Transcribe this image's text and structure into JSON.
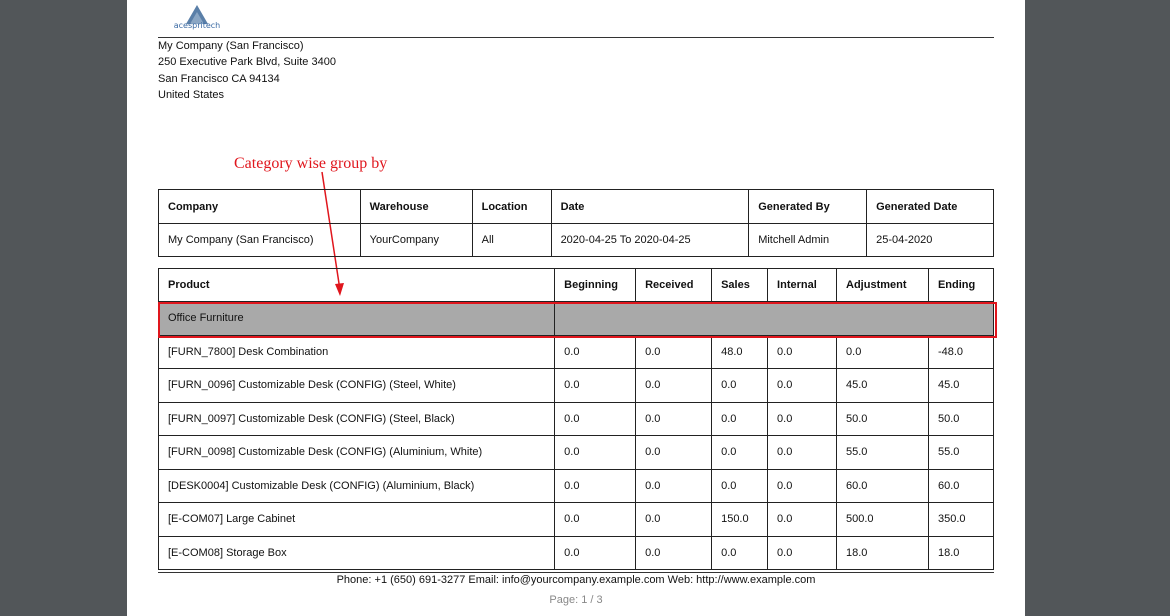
{
  "company": {
    "logo_text": "acespritech",
    "address_lines": [
      "My Company (San Francisco)",
      "250 Executive Park Blvd, Suite 3400",
      "San Francisco CA 94134",
      "United States"
    ]
  },
  "annotation": {
    "text": "Category wise group by",
    "color": "#e0161d"
  },
  "info_table": {
    "headers": [
      "Company",
      "Warehouse",
      "Location",
      "Date",
      "Generated By",
      "Generated Date"
    ],
    "values": [
      "My Company (San Francisco)",
      "YourCompany",
      "All",
      "2020-04-25 To 2020-04-25",
      "Mitchell Admin",
      "25-04-2020"
    ]
  },
  "inventory_table": {
    "headers": [
      "Product",
      "Beginning",
      "Received",
      "Sales",
      "Internal",
      "Adjustment",
      "Ending"
    ],
    "category": "Office Furniture",
    "rows": [
      [
        "[FURN_7800] Desk Combination",
        "0.0",
        "0.0",
        "48.0",
        "0.0",
        "0.0",
        "-48.0"
      ],
      [
        "[FURN_0096] Customizable Desk (CONFIG) (Steel, White)",
        "0.0",
        "0.0",
        "0.0",
        "0.0",
        "45.0",
        "45.0"
      ],
      [
        "[FURN_0097] Customizable Desk (CONFIG) (Steel, Black)",
        "0.0",
        "0.0",
        "0.0",
        "0.0",
        "50.0",
        "50.0"
      ],
      [
        "[FURN_0098] Customizable Desk (CONFIG) (Aluminium, White)",
        "0.0",
        "0.0",
        "0.0",
        "0.0",
        "55.0",
        "55.0"
      ],
      [
        "[DESK0004] Customizable Desk (CONFIG) (Aluminium, Black)",
        "0.0",
        "0.0",
        "0.0",
        "0.0",
        "60.0",
        "60.0"
      ],
      [
        "[E-COM07] Large Cabinet",
        "0.0",
        "0.0",
        "150.0",
        "0.0",
        "500.0",
        "350.0"
      ],
      [
        "[E-COM08] Storage Box",
        "0.0",
        "0.0",
        "0.0",
        "0.0",
        "18.0",
        "18.0"
      ]
    ]
  },
  "footer": {
    "contact": "Phone: +1 (650) 691-3277  Email: info@yourcompany.example.com  Web: http://www.example.com",
    "page": "Page: 1 / 3"
  }
}
